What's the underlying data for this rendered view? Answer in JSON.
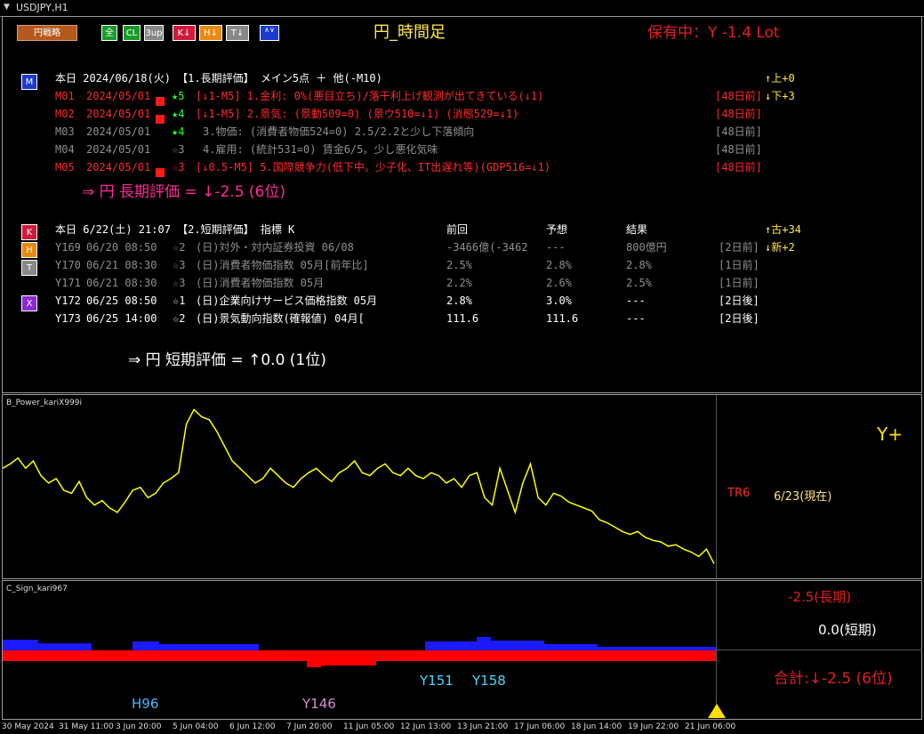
{
  "window": {
    "title": "USDJPY,H1"
  },
  "toolbar": {
    "strategy_label": "円戦略",
    "btn_all": "全",
    "btn_cl": "CL",
    "btn_3up": "3up",
    "btn_k": "K↓",
    "btn_h": "H↓",
    "btn_t": "T↓",
    "btn_av": "∧∨"
  },
  "header": {
    "center_title": "円_時間足",
    "position_status": "保有中：Y -1.4 Lot"
  },
  "long_term": {
    "header": "本日  2024/06/18(火)  【1.長期評価】 メイン5点 ＋ 他(-M10)",
    "right_top_1": "↑上+0",
    "right_top_2": "↓下+3",
    "rows": [
      {
        "id": "M01",
        "date": "2024/05/01",
        "stars": "★5",
        "text": "[↓1-M5] 1.金利: 0%(悪目立ち)/落干利上げ観測が出てきている(↓1)",
        "age": "[48日前]"
      },
      {
        "id": "M02",
        "date": "2024/05/01",
        "stars": "★4",
        "text": "[↓1-M5] 2.景気: (景動509=0) (景ウ510=↓1) (消態529=↓1)",
        "age": "[48日前]"
      },
      {
        "id": "M03",
        "date": "2024/05/01",
        "stars": "★4",
        "text": "3.物価: (消費者物価524=0) 2.5/2.2と少し下落傾向",
        "age": "[48日前]"
      },
      {
        "id": "M04",
        "date": "2024/05/01",
        "stars": "☆3",
        "text": "4.雇用: (統計531=0) 賃金6/5。少し悪化気味",
        "age": "[48日前]"
      },
      {
        "id": "M05",
        "date": "2024/05/01",
        "stars": "☆3",
        "text": "[↓0.5-M5] 5.国際競争力(低下中。少子化、IT出遅れ等)(GDP516=↓1)",
        "age": "[48日前]"
      }
    ],
    "summary": "⇒ 円 長期評価 = ↓-2.5 (6位)"
  },
  "short_term": {
    "header": "本日  6/22(土) 21:07   【2.短期評価】 指標 K",
    "col_prev": "前回",
    "col_forecast": "予想",
    "col_result": "結果",
    "right_top_1": "↑古+34",
    "right_top_2": "↓新+2",
    "rows": [
      {
        "id": "Y169",
        "datetime": "06/20 08:50",
        "stars": "☆2",
        "name": "(日)対外・対内証券投資 06/08",
        "prev": "-3466億(-3462",
        "forecast": "---",
        "result": "800億円",
        "age": "[2日前]"
      },
      {
        "id": "Y170",
        "datetime": "06/21 08:30",
        "stars": "☆3",
        "name": "(日)消費者物価指数 05月[前年比]",
        "prev": "2.5%",
        "forecast": "2.8%",
        "result": "2.8%",
        "age": "[1日前]"
      },
      {
        "id": "Y171",
        "datetime": "06/21 08:30",
        "stars": "☆3",
        "name": "(日)消費者物価指数 05月",
        "prev": "2.2%",
        "forecast": "2.6%",
        "result": "2.5%",
        "age": "[1日前]"
      },
      {
        "id": "Y172",
        "datetime": "06/25 08:50",
        "stars": "☆1",
        "name": "(日)企業向けサービス価格指数 05月",
        "prev": "2.8%",
        "forecast": "3.0%",
        "result": "---",
        "age": "[2日後]"
      },
      {
        "id": "Y173",
        "datetime": "06/25 14:00",
        "stars": "☆2",
        "name": "(日)景気動向指数(確報値) 04月[",
        "prev": "111.6",
        "forecast": "111.6",
        "result": "---",
        "age": "[2日後]"
      }
    ],
    "summary": "⇒ 円 短期評価 = ↑0.0 (1位)"
  },
  "side_buttons": {
    "m": "M",
    "k": "K",
    "h": "H",
    "t": "T",
    "x": "X"
  },
  "power_panel": {
    "label": "B_Power_kariX999i",
    "signal": "Y+",
    "tr_label": "TR6",
    "now_label": "6/23(現在)"
  },
  "sign_panel": {
    "label": "C_Sign_kari967",
    "long_value": "-2.5(長期)",
    "short_value": "0.0(短期)",
    "total": "合計:↓-2.5 (6位)",
    "markers": {
      "h96": "H96",
      "y146": "Y146",
      "y151": "Y151",
      "y158": "Y158"
    }
  },
  "x_axis": {
    "labels": [
      "30 May 2024",
      "31 May 11:00",
      "3 Jun 20:00",
      "5 Jun 04:00",
      "6 Jun 12:00",
      "7 Jun 20:00",
      "11 Jun 05:00",
      "12 Jun 13:00",
      "13 Jun 21:00",
      "17 Jun 06:00",
      "18 Jun 14:00",
      "19 Jun 22:00",
      "21 Jun 06:00"
    ]
  },
  "colors": {
    "power_line": "#ffff00",
    "blue_bar": "#1a1aff",
    "red_bar": "#ff0000",
    "marker": "#ffe000"
  },
  "chart_data": {
    "type": "line",
    "title": "B_Power_kariX999i",
    "x_range": [
      "30 May 2024",
      "21 Jun 06:00"
    ],
    "values": [
      0.55,
      0.58,
      0.62,
      0.55,
      0.6,
      0.5,
      0.45,
      0.48,
      0.4,
      0.38,
      0.46,
      0.35,
      0.3,
      0.33,
      0.28,
      0.25,
      0.32,
      0.4,
      0.42,
      0.35,
      0.38,
      0.45,
      0.48,
      0.52,
      0.85,
      0.95,
      0.9,
      0.88,
      0.8,
      0.7,
      0.6,
      0.55,
      0.5,
      0.45,
      0.48,
      0.55,
      0.5,
      0.45,
      0.42,
      0.48,
      0.52,
      0.55,
      0.5,
      0.46,
      0.52,
      0.55,
      0.6,
      0.52,
      0.5,
      0.55,
      0.58,
      0.52,
      0.5,
      0.55,
      0.5,
      0.48,
      0.52,
      0.5,
      0.45,
      0.48,
      0.42,
      0.5,
      0.52,
      0.35,
      0.3,
      0.55,
      0.4,
      0.25,
      0.45,
      0.58,
      0.35,
      0.3,
      0.38,
      0.36,
      0.32,
      0.3,
      0.28,
      0.26,
      0.2,
      0.18,
      0.15,
      0.12,
      0.1,
      0.12,
      0.08,
      0.06,
      0.05,
      0.02,
      0.03,
      0.0,
      -0.02,
      -0.05,
      0.0,
      -0.1
    ]
  }
}
